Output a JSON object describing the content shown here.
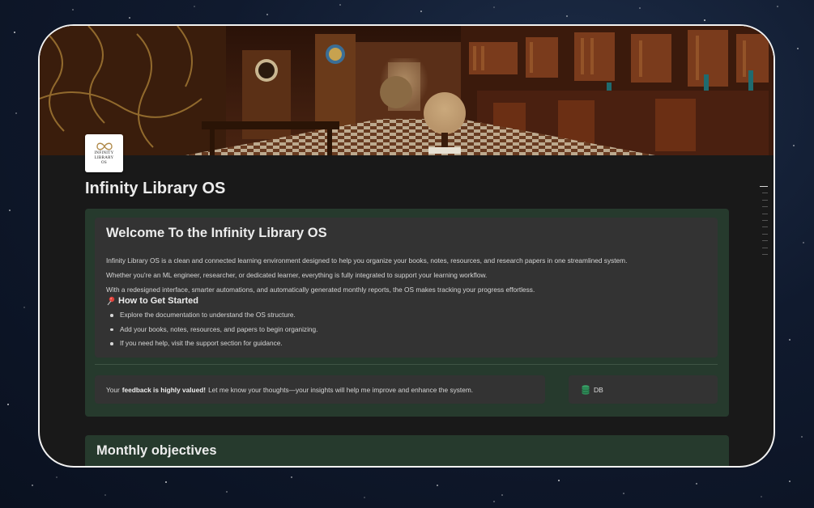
{
  "page": {
    "title": "Infinity Library OS",
    "icon_text": [
      "INFINITY",
      "LIBRARY",
      "OS"
    ]
  },
  "welcome": {
    "title": "Welcome To the Infinity Library OS",
    "paragraphs": [
      "Infinity Library OS is a clean and connected learning environment designed to help you organize your books, notes, resources, and research papers in one streamlined system.",
      "Whether you're an ML engineer, researcher, or dedicated learner, everything is fully integrated to support your learning workflow.",
      "With a redesigned interface, smarter automations, and automatically generated monthly reports, the OS makes tracking your progress effortless."
    ],
    "how_to_title": "How to Get Started",
    "how_to_icon": "pushpin-icon",
    "steps": [
      "Explore the documentation to understand the OS structure.",
      "Add your books, notes, resources, and papers to begin organizing.",
      "If you need help, visit the support section for guidance."
    ]
  },
  "feedback": {
    "prefix": "Your",
    "emphasis": "feedback is highly valued!",
    "suffix": "Let me know your thoughts—your insights will help me improve and enhance the system."
  },
  "db_link": {
    "label": "DB",
    "icon": "database-icon"
  },
  "monthly": {
    "title": "Monthly objectives"
  },
  "colors": {
    "callout_bg": "#263a2d",
    "card_bg": "#333333",
    "page_bg": "#191919",
    "db_icon": "#3aa86b"
  }
}
